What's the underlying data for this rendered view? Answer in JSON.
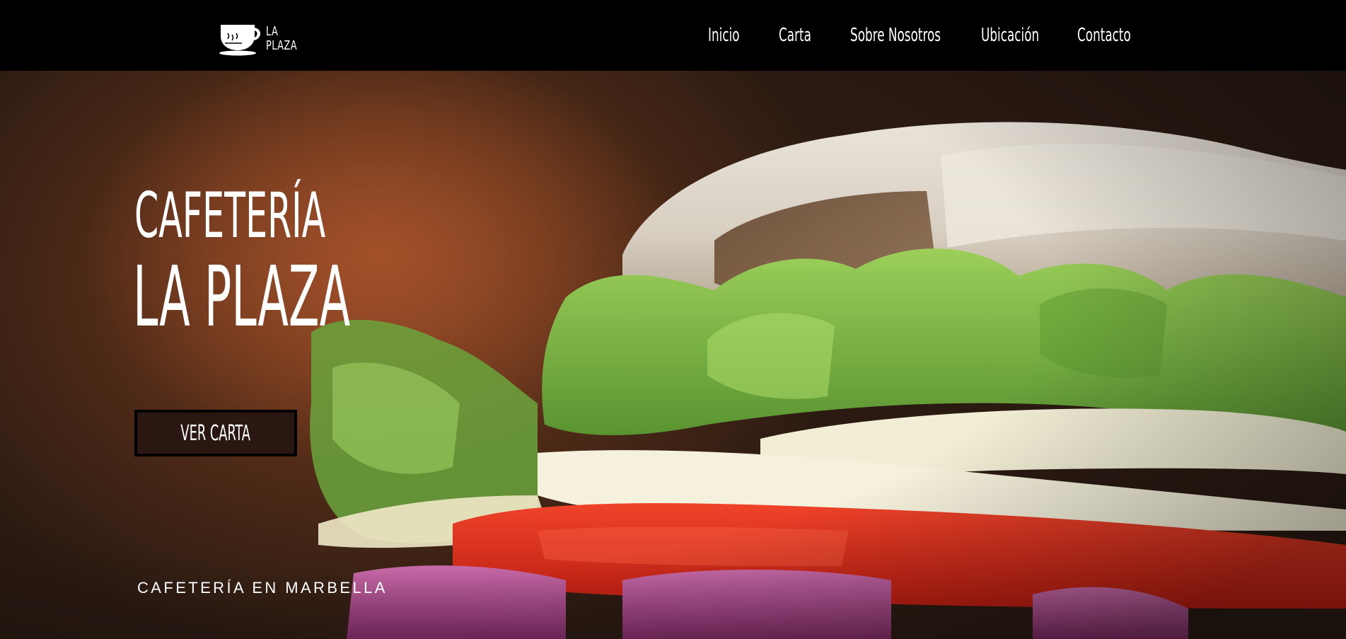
{
  "header": {
    "logo": {
      "icon": "coffee-cup-icon",
      "line1": "LA",
      "line2": "PLAZA"
    },
    "nav": [
      {
        "label": "Inicio"
      },
      {
        "label": "Carta"
      },
      {
        "label": "Sobre Nosotros"
      },
      {
        "label": "Ubicación"
      },
      {
        "label": "Contacto"
      }
    ]
  },
  "hero": {
    "title_line1": "CAFETERÍA",
    "title_line2": "LA PLAZA",
    "cta_label": "VER CARTA",
    "tagline": "CAFETERÍA EN MARBELLA",
    "image": "sandwich-photo"
  },
  "colors": {
    "header_bg": "#000000",
    "text": "#ffffff",
    "button_bg": "#2a1712",
    "button_border": "#000000"
  }
}
